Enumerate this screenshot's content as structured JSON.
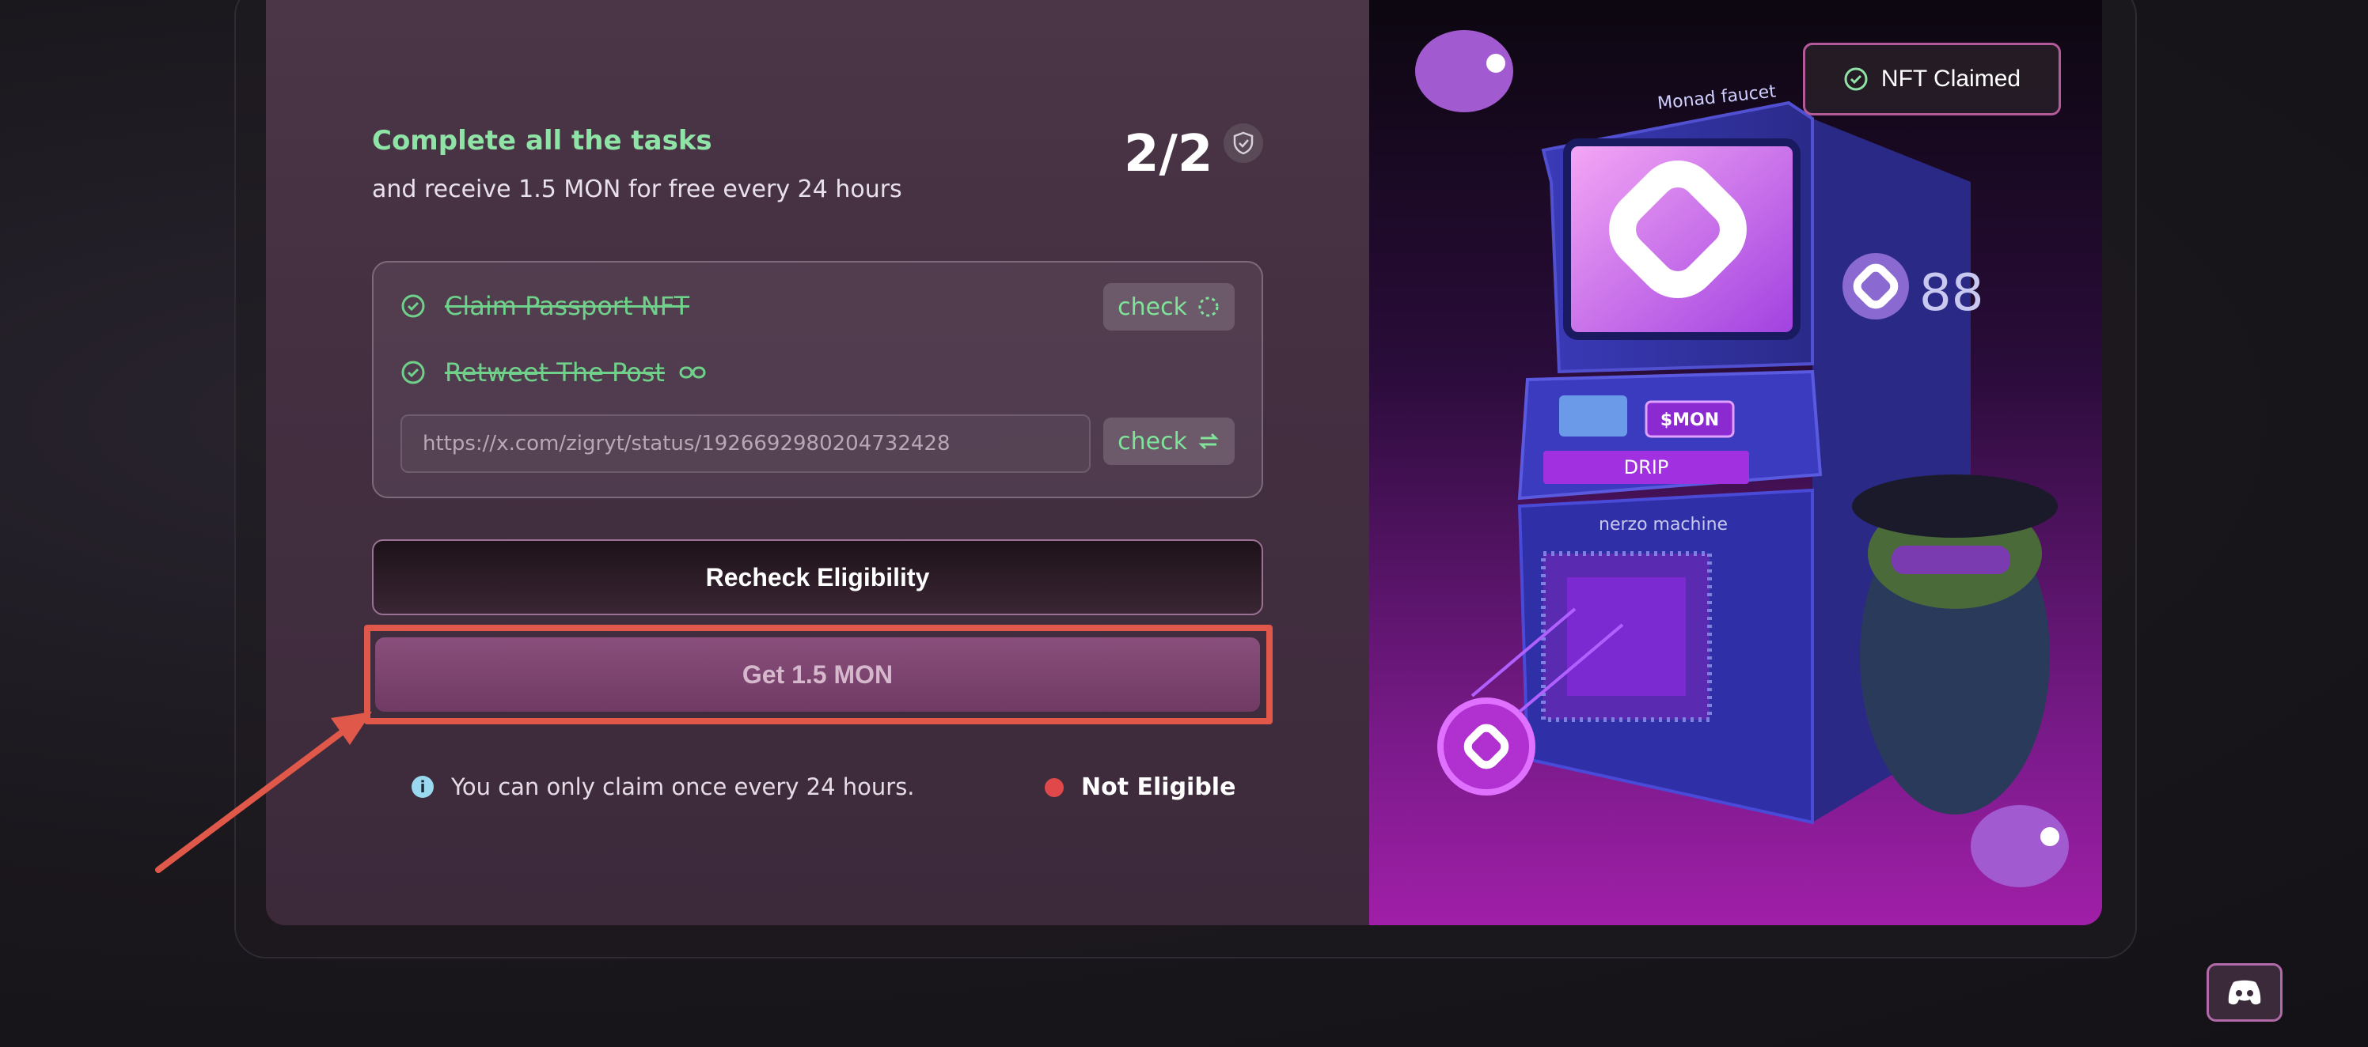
{
  "tasks_section": {
    "title": "Complete all the tasks",
    "subtitle": "and receive 1.5 MON for free every 24 hours",
    "progress": "2/2"
  },
  "tasks": [
    {
      "label": "Claim Passport NFT",
      "done": true,
      "check_label": "check"
    },
    {
      "label": "Retweet The Post",
      "done": true
    }
  ],
  "url_input": {
    "value": "https://x.com/zigryt/status/1926692980204732428",
    "check_label": "check"
  },
  "buttons": {
    "recheck": "Recheck Eligibility",
    "get": "Get 1.5 MON"
  },
  "info": {
    "note": "You can only claim once every 24 hours.",
    "status": "Not Eligible",
    "status_color": "#e0484a"
  },
  "nft_badge": {
    "label": "NFT Claimed"
  },
  "machine": {
    "title": "Monad faucet",
    "ticker": "$MON",
    "drip": "DRIP",
    "brand": "nerzo machine",
    "side_number": "88"
  },
  "colors": {
    "accent_green": "#8fe3a6",
    "highlight_red": "#e0584a",
    "panel_purple": "#a01fa8"
  }
}
